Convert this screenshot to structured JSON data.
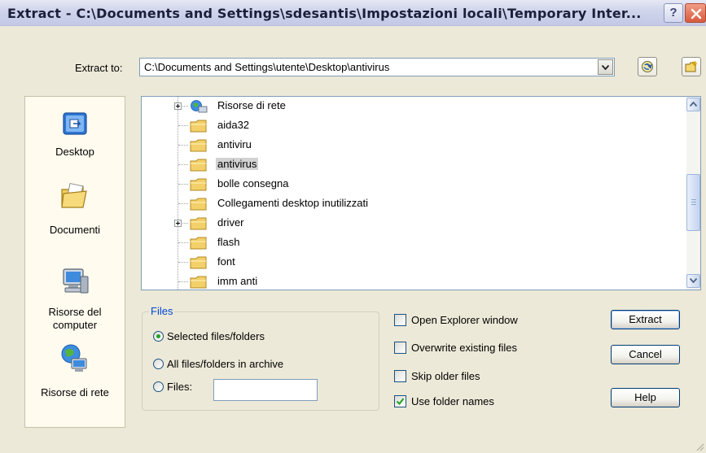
{
  "window": {
    "title": "Extract - C:\\Documents and Settings\\sdesantis\\Impostazioni locali\\Temporary Inter...",
    "help_label": "?"
  },
  "extract_to": {
    "label": "Extract to:",
    "value": "C:\\Documents and Settings\\utente\\Desktop\\antivirus"
  },
  "places": [
    {
      "label": "Desktop",
      "icon": "desktop-icon"
    },
    {
      "label": "Documenti",
      "icon": "documents-folder-icon"
    },
    {
      "label": "Risorse del computer",
      "icon": "my-computer-icon"
    },
    {
      "label": "Risorse di rete",
      "icon": "network-places-icon"
    }
  ],
  "tree": {
    "items": [
      {
        "label": "Risorse di rete",
        "expandable": true,
        "icon": "network-icon",
        "selected": false
      },
      {
        "label": "aida32",
        "expandable": false,
        "icon": "folder-icon",
        "selected": false
      },
      {
        "label": "antiviru",
        "expandable": false,
        "icon": "folder-icon",
        "selected": false
      },
      {
        "label": "antivirus",
        "expandable": false,
        "icon": "folder-icon",
        "selected": true
      },
      {
        "label": "bolle consegna",
        "expandable": false,
        "icon": "folder-icon",
        "selected": false
      },
      {
        "label": "Collegamenti desktop inutilizzati",
        "expandable": false,
        "icon": "folder-icon",
        "selected": false
      },
      {
        "label": "driver",
        "expandable": true,
        "icon": "folder-icon",
        "selected": false
      },
      {
        "label": "flash",
        "expandable": false,
        "icon": "folder-icon",
        "selected": false
      },
      {
        "label": "font",
        "expandable": false,
        "icon": "folder-icon",
        "selected": false
      },
      {
        "label": "imm anti",
        "expandable": false,
        "icon": "folder-icon",
        "selected": false
      }
    ]
  },
  "files_group": {
    "title": "Files",
    "options": [
      {
        "label": "Selected files/folders",
        "checked": true
      },
      {
        "label": "All files/folders in archive",
        "checked": false
      },
      {
        "label": "Files:",
        "checked": false
      }
    ],
    "files_value": ""
  },
  "options": [
    {
      "label": "Open Explorer window",
      "checked": false
    },
    {
      "label": "Overwrite existing files",
      "checked": false
    },
    {
      "label": "Skip older files",
      "checked": false
    },
    {
      "label": "Use folder names",
      "checked": true
    }
  ],
  "buttons": {
    "extract": "Extract",
    "cancel": "Cancel",
    "help": "Help"
  },
  "colors": {
    "dialog_bg": "#ECE9D8",
    "group_title": "#0046D5",
    "selection": "#D2D2D2",
    "radio_dot": "#21A121",
    "close_button": "#D65A3E"
  }
}
